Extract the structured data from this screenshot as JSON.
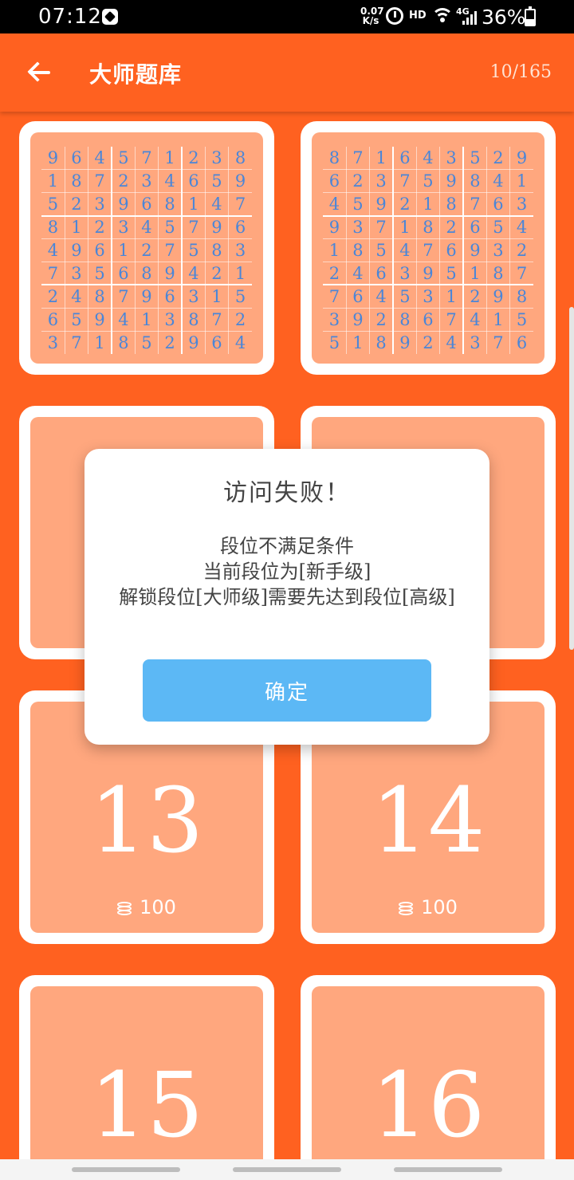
{
  "status_bar": {
    "time": "07:12",
    "net_speed_top": "0.07",
    "net_speed_bottom": "K/s",
    "hd": "HD",
    "network": "4G",
    "battery": "36%"
  },
  "app_bar": {
    "title": "大师题库",
    "count": "10/165"
  },
  "puzzles": [
    {
      "grid": [
        [
          "9",
          "6",
          "4",
          "5",
          "7",
          "1",
          "2",
          "3",
          "8"
        ],
        [
          "1",
          "8",
          "7",
          "2",
          "3",
          "4",
          "6",
          "5",
          "9"
        ],
        [
          "5",
          "2",
          "3",
          "9",
          "6",
          "8",
          "1",
          "4",
          "7"
        ],
        [
          "8",
          "1",
          "2",
          "3",
          "4",
          "5",
          "7",
          "9",
          "6"
        ],
        [
          "4",
          "9",
          "6",
          "1",
          "2",
          "7",
          "5",
          "8",
          "3"
        ],
        [
          "7",
          "3",
          "5",
          "6",
          "8",
          "9",
          "4",
          "2",
          "1"
        ],
        [
          "2",
          "4",
          "8",
          "7",
          "9",
          "6",
          "3",
          "1",
          "5"
        ],
        [
          "6",
          "5",
          "9",
          "4",
          "1",
          "3",
          "8",
          "7",
          "2"
        ],
        [
          "3",
          "7",
          "1",
          "8",
          "5",
          "2",
          "9",
          "6",
          "4"
        ]
      ]
    },
    {
      "grid": [
        [
          "8",
          "7",
          "1",
          "6",
          "4",
          "3",
          "5",
          "2",
          "9"
        ],
        [
          "6",
          "2",
          "3",
          "7",
          "5",
          "9",
          "8",
          "4",
          "1"
        ],
        [
          "4",
          "5",
          "9",
          "2",
          "1",
          "8",
          "7",
          "6",
          "3"
        ],
        [
          "9",
          "3",
          "7",
          "1",
          "8",
          "2",
          "6",
          "5",
          "4"
        ],
        [
          "1",
          "8",
          "5",
          "4",
          "7",
          "6",
          "9",
          "3",
          "2"
        ],
        [
          "2",
          "4",
          "6",
          "3",
          "9",
          "5",
          "1",
          "8",
          "7"
        ],
        [
          "7",
          "6",
          "4",
          "5",
          "3",
          "1",
          "2",
          "9",
          "8"
        ],
        [
          "3",
          "9",
          "2",
          "8",
          "6",
          "7",
          "4",
          "1",
          "5"
        ],
        [
          "5",
          "1",
          "8",
          "9",
          "2",
          "4",
          "3",
          "7",
          "6"
        ]
      ]
    }
  ],
  "levels": [
    {
      "number": "13",
      "cost": "100"
    },
    {
      "number": "14",
      "cost": "100"
    },
    {
      "number": "15",
      "cost": ""
    },
    {
      "number": "16",
      "cost": ""
    }
  ],
  "dialog": {
    "title": "访问失败！",
    "line1": "段位不满足条件",
    "line2": "当前段位为[新手级]",
    "line3": "解锁段位[大师级]需要先达到段位[高级]",
    "confirm": "确定"
  },
  "icons": {
    "back": "arrow-left-icon",
    "coin": "coin-stack-icon"
  },
  "colors": {
    "primary": "#FF6120",
    "tile": "#FFA77E",
    "digit": "#4A86D8",
    "button": "#5CB8F5"
  }
}
